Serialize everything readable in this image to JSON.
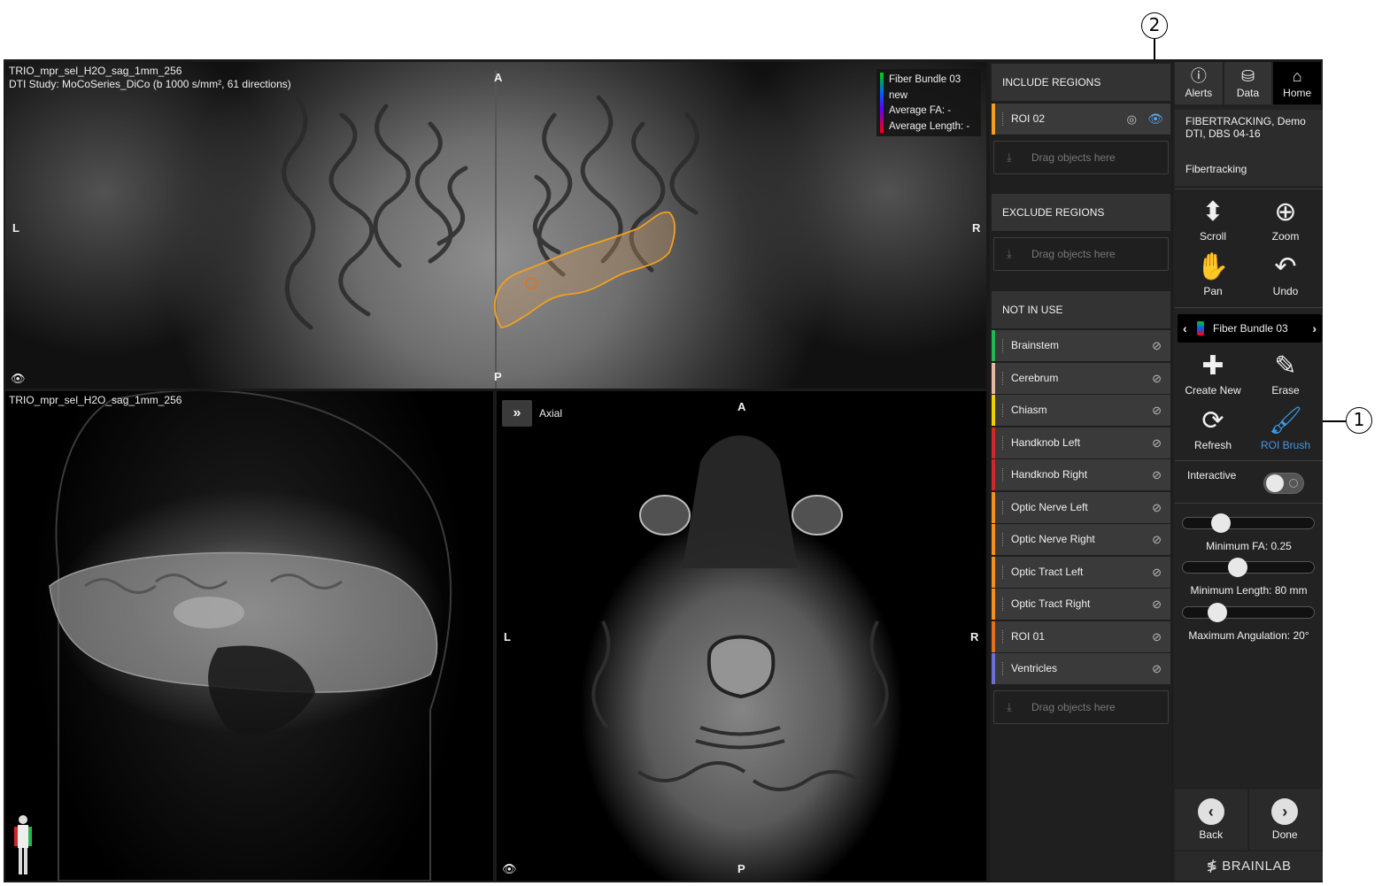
{
  "callouts": {
    "one": "1",
    "two": "2"
  },
  "top_view": {
    "line1": "TRIO_mpr_sel_H2O_sag_1mm_256",
    "line2": "DTI Study: MoCoSeries_DiCo (b 1000 s/mm², 61 directions)",
    "orient": {
      "top": "A",
      "left": "L",
      "right": "R",
      "bottom": "P"
    },
    "legend": {
      "line1": "Fiber Bundle 03",
      "line2": "new",
      "line3": "Average FA:  -",
      "line4": "Average Length:  -"
    }
  },
  "bl_view": {
    "line1": "TRIO_mpr_sel_H2O_sag_1mm_256"
  },
  "br_view": {
    "expand_glyph": "»",
    "label": "Axial",
    "orient": {
      "top": "A",
      "left": "L",
      "right": "R",
      "bottom": "P"
    }
  },
  "regions": {
    "include": {
      "title": "INCLUDE REGIONS",
      "items": [
        {
          "label": "ROI 02",
          "color": "#f0a020"
        }
      ]
    },
    "exclude": {
      "title": "EXCLUDE REGIONS"
    },
    "not_in_use": {
      "title": "NOT IN USE",
      "items": [
        {
          "label": "Brainstem",
          "color": "#22b84c"
        },
        {
          "label": "Cerebrum",
          "color": "#e6b8a0"
        },
        {
          "label": "Chiasm",
          "color": "#f0d000"
        },
        {
          "label": "Handknob Left",
          "color": "#d02828"
        },
        {
          "label": "Handknob Right",
          "color": "#d02828"
        },
        {
          "label": "Optic Nerve Left",
          "color": "#f09020"
        },
        {
          "label": "Optic Nerve Right",
          "color": "#f09020"
        },
        {
          "label": "Optic Tract Left",
          "color": "#f09020"
        },
        {
          "label": "Optic Tract Right",
          "color": "#f09020"
        },
        {
          "label": "ROI 01",
          "color": "#e07020"
        },
        {
          "label": "Ventricles",
          "color": "#6a70d0"
        }
      ]
    },
    "drop_text": "Drag objects here"
  },
  "tools": {
    "nav": [
      {
        "label": "Alerts",
        "icon": "info-icon"
      },
      {
        "label": "Data",
        "icon": "data-icon"
      },
      {
        "label": "Home",
        "icon": "home-icon"
      }
    ],
    "title": "FIBERTRACKING, Demo DTI, DBS 04-16",
    "subtitle": "Fibertracking",
    "scroll": "Scroll",
    "zoom": "Zoom",
    "pan": "Pan",
    "undo": "Undo",
    "bundle": "Fiber Bundle 03",
    "create_new": "Create New",
    "erase": "Erase",
    "refresh": "Refresh",
    "roi_brush": "ROI Brush",
    "interactive": "Interactive",
    "sliders": [
      {
        "label": "Minimum FA:  0.25",
        "fraction": 0.25
      },
      {
        "label": "Minimum Length:  80 mm",
        "fraction": 0.4
      },
      {
        "label": "Maximum Angulation:  20°",
        "fraction": 0.22
      }
    ],
    "back": "Back",
    "done": "Done",
    "brand": "BRAINLAB"
  },
  "colors": {
    "accent": "#3d9ae8",
    "roi_outline": "#f0a020"
  }
}
